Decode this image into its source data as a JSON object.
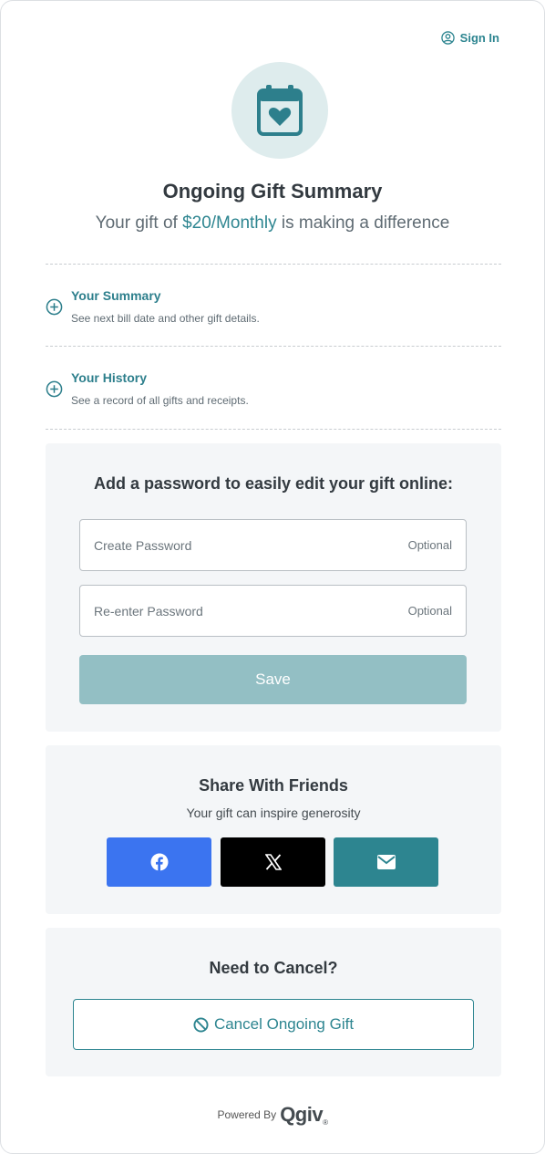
{
  "header": {
    "signin_label": "Sign In"
  },
  "summary": {
    "title": "Ongoing Gift Summary",
    "subtitle_prefix": "Your gift of ",
    "amount": "$20/Monthly",
    "subtitle_suffix": " is making a difference"
  },
  "accordion": [
    {
      "title": "Your Summary",
      "description": "See next bill date and other gift details."
    },
    {
      "title": "Your History",
      "description": "See a record of all gifts and receipts."
    }
  ],
  "password": {
    "title": "Add a password to easily edit your gift online:",
    "create_placeholder": "Create Password",
    "reenter_placeholder": "Re-enter Password",
    "optional_label": "Optional",
    "save_label": "Save"
  },
  "share": {
    "title": "Share With Friends",
    "subtitle": "Your gift can inspire generosity",
    "buttons": [
      {
        "icon": "facebook-icon",
        "color": "#3b74f0"
      },
      {
        "icon": "x-icon",
        "color": "#000000"
      },
      {
        "icon": "envelope-icon",
        "color": "#2d8590"
      }
    ]
  },
  "cancel": {
    "title": "Need to Cancel?",
    "button_label": "Cancel Ongoing Gift"
  },
  "footer": {
    "powered_by": "Powered By",
    "logo_text": "Qgiv",
    "logo_mark": "®"
  },
  "colors": {
    "accent": "#2d8590",
    "save_disabled": "#93bfc4",
    "panel_bg": "#f4f6f8",
    "icon_circle_bg": "#deeced"
  }
}
